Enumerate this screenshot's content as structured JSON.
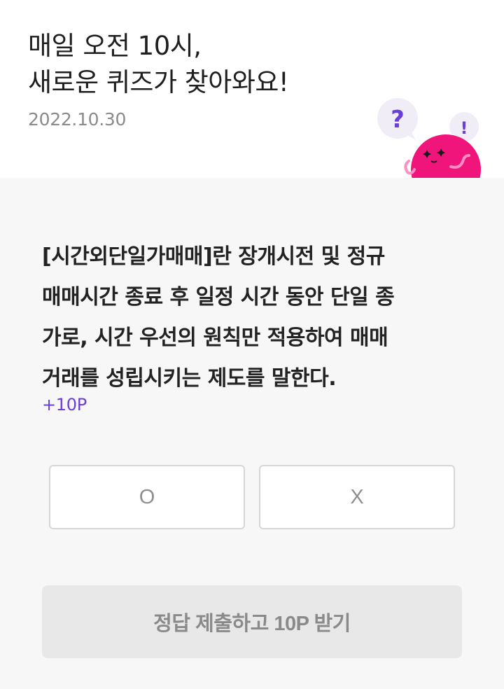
{
  "header": {
    "title_lines": [
      "매일 오전 10시,",
      "새로운 퀴즈가 찾아와요!"
    ],
    "date": "2022.10.30"
  },
  "mascot": {
    "question_mark": "?",
    "exclamation": "!",
    "body_color": "#f0157a",
    "bubble_color": "#f0edf7",
    "accent_color": "#6a3fd8"
  },
  "quiz": {
    "question_lines": [
      "[시간외단일가매매]란 장개시전 및 정규",
      "매매시간 종료 후 일정 시간 동안 단일 종",
      "가로, 시간 우선의 원칙만 적용하여 매매",
      "거래를 성립시키는 제도를 말한다."
    ],
    "points": "+10P",
    "answers": {
      "o_label": "O",
      "x_label": "X"
    },
    "submit_label": "정답 제출하고 10P 받기"
  }
}
